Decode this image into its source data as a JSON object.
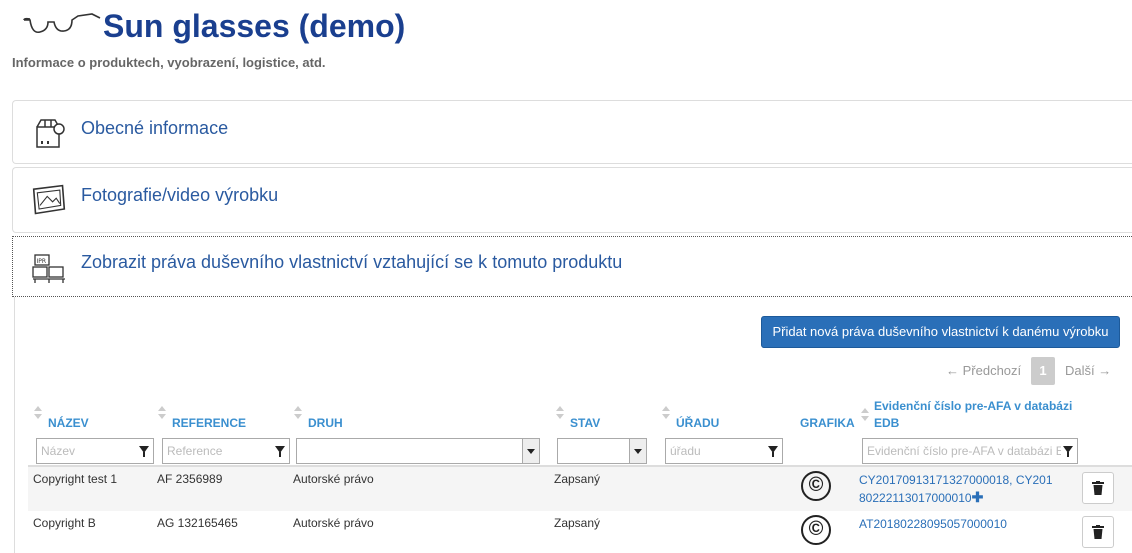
{
  "header": {
    "title": "Sun glasses (demo)",
    "subtitle": "Informace o produktech, vyobrazení, logistice, atd."
  },
  "panels": [
    {
      "label": "Obecné informace",
      "icon": "box-info-icon"
    },
    {
      "label": "Fotografie/video výrobku",
      "icon": "photo-icon"
    },
    {
      "label": "Zobrazit práva duševního vlastnictví vztahující se k tomuto produktu",
      "icon": "ipr-boxes-icon"
    }
  ],
  "actions": {
    "add_label": "Přidat nová práva duševního vlastnictví k danému výrobku"
  },
  "pagination": {
    "prev": "← Předchozí",
    "current": "1",
    "next": "Další →"
  },
  "table": {
    "headers": {
      "nazev": "NÁZEV",
      "reference": "REFERENCE",
      "druh": "DRUH",
      "stav": "STAV",
      "uradu": "ÚŘADU",
      "grafika": "GRAFIKA",
      "edb": "Evidenční číslo pre-AFA v databázi EDB"
    },
    "filters": {
      "nazev": "Název",
      "reference": "Reference",
      "druh": "",
      "stav": "",
      "uradu": "úřadu",
      "edb": "Evidenční číslo pre-AFA v databázi EDB"
    },
    "rows": [
      {
        "nazev": "Copyright test 1",
        "reference": "AF 2356989",
        "druh": "Autorské právo",
        "stav": "Zapsaný",
        "grafika": "©",
        "edb_line1": "CY20170913171327000018, CY201",
        "edb_line2": "80222113017000010",
        "edb_more": "✚"
      },
      {
        "nazev": "Copyright B",
        "reference": "AG 132165465",
        "druh": "Autorské právo",
        "stav": "Zapsaný",
        "grafika": "©",
        "edb_line1": "AT20180228095057000010",
        "edb_line2": "",
        "edb_more": ""
      }
    ]
  }
}
